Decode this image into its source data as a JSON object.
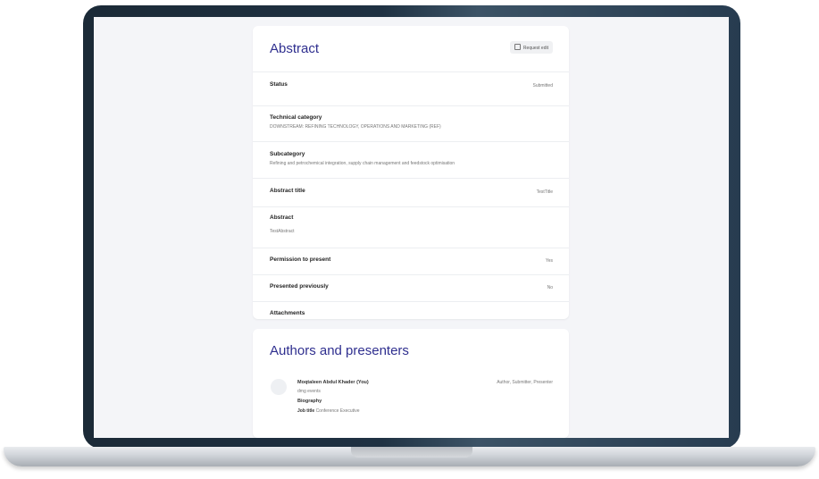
{
  "abstract": {
    "title": "Abstract",
    "request_edit_label": "Request edit",
    "rows": [
      {
        "label": "Status",
        "value": "Submitted"
      },
      {
        "label": "Technical category",
        "value": "DOWNSTREAM: REFINING TECHNOLOGY, OPERATIONS AND MARKETING (REF)"
      },
      {
        "label": "Subcategory",
        "value": "Refining and petrochemical integration, supply chain management and feedstock optimisation"
      },
      {
        "label": "Abstract title",
        "value": "TestTitle"
      },
      {
        "label": "Abstract",
        "value": "TestAbstract"
      },
      {
        "label": "Permission to present",
        "value": "Yes"
      },
      {
        "label": "Presented previously",
        "value": "No"
      },
      {
        "label": "Attachments",
        "value": ""
      }
    ]
  },
  "authors": {
    "title": "Authors and presenters",
    "items": [
      {
        "name": "Moqtaleen Abdul Khader (You)",
        "org": "dmg events",
        "bio_label": "Biography",
        "job_label": "Job title",
        "job_value": "Conference Executive",
        "roles": "Author, Submitter, Presenter"
      }
    ]
  }
}
